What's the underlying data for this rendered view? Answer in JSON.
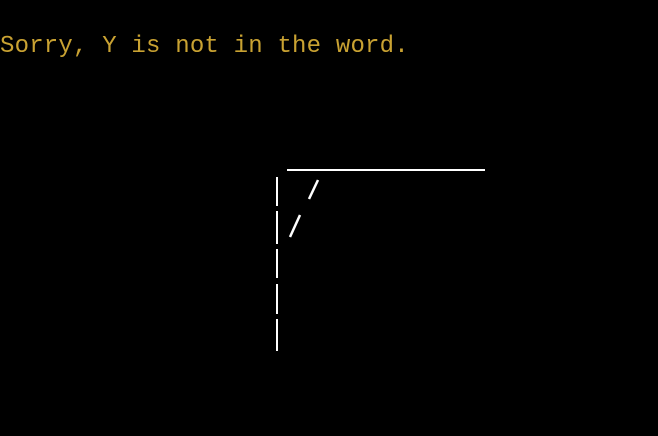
{
  "colors": {
    "background": "#000000",
    "message": "#c9a232",
    "gallows": "#ffffff"
  },
  "status_message": "Sorry, Y is not in the word."
}
